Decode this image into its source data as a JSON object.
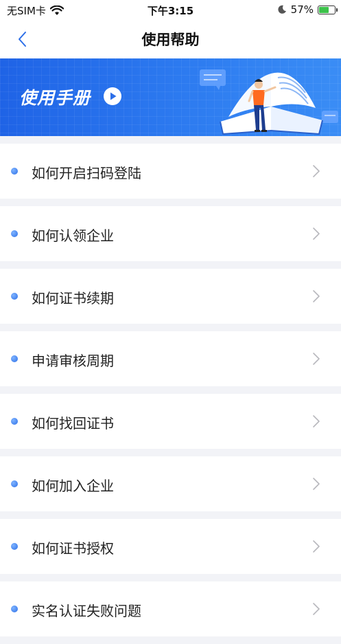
{
  "status": {
    "carrier": "无SIM卡",
    "time": "下午3:15",
    "battery": "57%",
    "battery_level": 0.57
  },
  "nav": {
    "title": "使用帮助",
    "back_icon": "chevron-left-icon"
  },
  "banner": {
    "title": "使用手册",
    "play_icon": "play-icon"
  },
  "help_items": [
    {
      "label": "如何开启扫码登陆"
    },
    {
      "label": "如何认领企业"
    },
    {
      "label": "如何证书续期"
    },
    {
      "label": "申请审核周期"
    },
    {
      "label": "如何找回证书"
    },
    {
      "label": "如何加入企业"
    },
    {
      "label": "如何证书授权"
    },
    {
      "label": "实名认证失败问题"
    }
  ],
  "colors": {
    "accent": "#2d7bf0",
    "background": "#f2f3f7"
  }
}
